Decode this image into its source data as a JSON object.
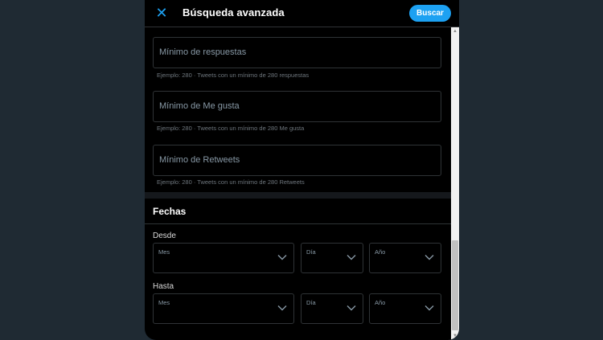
{
  "header": {
    "close_icon": "close-icon",
    "title": "Búsqueda avanzada",
    "search_label": "Buscar"
  },
  "engagement": {
    "replies": {
      "label": "Mínimo de respuestas",
      "hint": "Ejemplo: 280 · Tweets con un mínimo de 280 respuestas"
    },
    "likes": {
      "label": "Mínimo de Me gusta",
      "hint": "Ejemplo: 280 · Tweets con un mínimo de 280 Me gusta"
    },
    "retweets": {
      "label": "Mínimo de Retweets",
      "hint": "Ejemplo: 280 · Tweets con un mínimo de 280 Retweets"
    }
  },
  "dates": {
    "section_title": "Fechas",
    "from": {
      "label": "Desde",
      "month": "Mes",
      "day": "Día",
      "year": "Año"
    },
    "to": {
      "label": "Hasta",
      "month": "Mes",
      "day": "Día",
      "year": "Año"
    }
  },
  "colors": {
    "accent": "#1da1f2",
    "background": "#000000",
    "page_backdrop": "#1f2a33"
  }
}
